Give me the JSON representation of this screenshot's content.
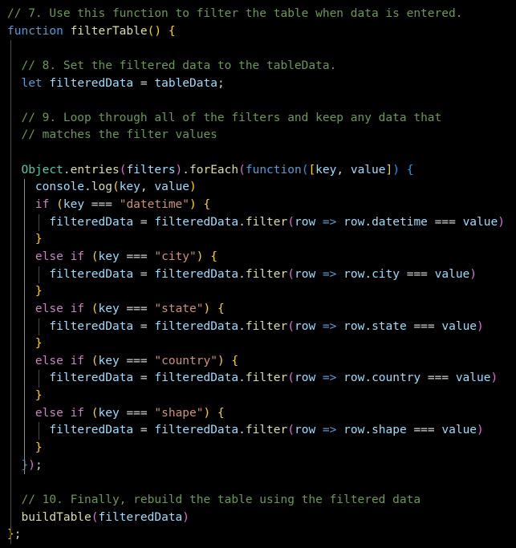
{
  "editor": {
    "language": "javascript",
    "theme": {
      "background": "#000000",
      "comment": "#6a9955",
      "keyword": "#569cd6",
      "control": "#c586c0",
      "function": "#dcdcaa",
      "variable": "#9cdcfe",
      "class": "#4ec9b0",
      "string": "#ce9178",
      "plain": "#d4d4d4",
      "bracket1": "#ffd700",
      "bracket2": "#da70d6",
      "bracket3": "#179fff"
    },
    "lines": [
      {
        "tokens": [
          [
            "tok-comment",
            "// 7. Use this function to filter the table when data is entered."
          ]
        ]
      },
      {
        "tokens": [
          [
            "tok-keyword",
            "function"
          ],
          [
            "tok-plain",
            " "
          ],
          [
            "tok-func",
            "filterTable"
          ],
          [
            "tok-b1",
            "()"
          ],
          [
            "tok-plain",
            " "
          ],
          [
            "tok-b1",
            "{"
          ]
        ]
      },
      {
        "tokens": []
      },
      {
        "tokens": [
          [
            "tok-plain",
            "  "
          ],
          [
            "tok-comment",
            "// 8. Set the filtered data to the tableData."
          ]
        ]
      },
      {
        "tokens": [
          [
            "tok-plain",
            "  "
          ],
          [
            "tok-keyword",
            "let"
          ],
          [
            "tok-plain",
            " "
          ],
          [
            "tok-var",
            "filteredData"
          ],
          [
            "tok-plain",
            " = "
          ],
          [
            "tok-var",
            "tableData"
          ],
          [
            "tok-plain",
            ";"
          ]
        ]
      },
      {
        "tokens": []
      },
      {
        "tokens": [
          [
            "tok-plain",
            "  "
          ],
          [
            "tok-comment",
            "// 9. Loop through all of the filters and keep any data that"
          ]
        ]
      },
      {
        "tokens": [
          [
            "tok-plain",
            "  "
          ],
          [
            "tok-comment",
            "// matches the filter values"
          ]
        ]
      },
      {
        "tokens": []
      },
      {
        "tokens": [
          [
            "tok-plain",
            "  "
          ],
          [
            "tok-class",
            "Object"
          ],
          [
            "tok-plain",
            "."
          ],
          [
            "tok-func",
            "entries"
          ],
          [
            "tok-b2",
            "("
          ],
          [
            "tok-var",
            "filters"
          ],
          [
            "tok-b2",
            ")"
          ],
          [
            "tok-plain",
            "."
          ],
          [
            "tok-func",
            "forEach"
          ],
          [
            "tok-b2",
            "("
          ],
          [
            "tok-keyword",
            "function"
          ],
          [
            "tok-b3",
            "("
          ],
          [
            "tok-b1",
            "["
          ],
          [
            "tok-var",
            "key"
          ],
          [
            "tok-plain",
            ", "
          ],
          [
            "tok-var",
            "value"
          ],
          [
            "tok-b1",
            "]"
          ],
          [
            "tok-b3",
            ")"
          ],
          [
            "tok-plain",
            " "
          ],
          [
            "tok-b3",
            "{"
          ]
        ]
      },
      {
        "tokens": [
          [
            "tok-plain",
            "    "
          ],
          [
            "tok-var",
            "console"
          ],
          [
            "tok-plain",
            "."
          ],
          [
            "tok-func",
            "log"
          ],
          [
            "tok-b1",
            "("
          ],
          [
            "tok-var",
            "key"
          ],
          [
            "tok-plain",
            ", "
          ],
          [
            "tok-var",
            "value"
          ],
          [
            "tok-b1",
            ")"
          ]
        ]
      },
      {
        "tokens": [
          [
            "tok-plain",
            "    "
          ],
          [
            "tok-ctrl",
            "if"
          ],
          [
            "tok-plain",
            " "
          ],
          [
            "tok-b1",
            "("
          ],
          [
            "tok-var",
            "key"
          ],
          [
            "tok-plain",
            " === "
          ],
          [
            "tok-string",
            "\"datetime\""
          ],
          [
            "tok-b1",
            ")"
          ],
          [
            "tok-plain",
            " "
          ],
          [
            "tok-b1",
            "{"
          ]
        ]
      },
      {
        "tokens": [
          [
            "tok-plain",
            "      "
          ],
          [
            "tok-var",
            "filteredData"
          ],
          [
            "tok-plain",
            " = "
          ],
          [
            "tok-var",
            "filteredData"
          ],
          [
            "tok-plain",
            "."
          ],
          [
            "tok-func",
            "filter"
          ],
          [
            "tok-b2",
            "("
          ],
          [
            "tok-var",
            "row"
          ],
          [
            "tok-plain",
            " "
          ],
          [
            "tok-keyword",
            "=>"
          ],
          [
            "tok-plain",
            " "
          ],
          [
            "tok-var",
            "row"
          ],
          [
            "tok-plain",
            "."
          ],
          [
            "tok-var",
            "datetime"
          ],
          [
            "tok-plain",
            " === "
          ],
          [
            "tok-var",
            "value"
          ],
          [
            "tok-b2",
            ")"
          ]
        ]
      },
      {
        "tokens": [
          [
            "tok-plain",
            "    "
          ],
          [
            "tok-b1",
            "}"
          ]
        ]
      },
      {
        "tokens": [
          [
            "tok-plain",
            "    "
          ],
          [
            "tok-ctrl",
            "else"
          ],
          [
            "tok-plain",
            " "
          ],
          [
            "tok-ctrl",
            "if"
          ],
          [
            "tok-plain",
            " "
          ],
          [
            "tok-b1",
            "("
          ],
          [
            "tok-var",
            "key"
          ],
          [
            "tok-plain",
            " === "
          ],
          [
            "tok-string",
            "\"city\""
          ],
          [
            "tok-b1",
            ")"
          ],
          [
            "tok-plain",
            " "
          ],
          [
            "tok-b1",
            "{"
          ]
        ]
      },
      {
        "tokens": [
          [
            "tok-plain",
            "      "
          ],
          [
            "tok-var",
            "filteredData"
          ],
          [
            "tok-plain",
            " = "
          ],
          [
            "tok-var",
            "filteredData"
          ],
          [
            "tok-plain",
            "."
          ],
          [
            "tok-func",
            "filter"
          ],
          [
            "tok-b2",
            "("
          ],
          [
            "tok-var",
            "row"
          ],
          [
            "tok-plain",
            " "
          ],
          [
            "tok-keyword",
            "=>"
          ],
          [
            "tok-plain",
            " "
          ],
          [
            "tok-var",
            "row"
          ],
          [
            "tok-plain",
            "."
          ],
          [
            "tok-var",
            "city"
          ],
          [
            "tok-plain",
            " === "
          ],
          [
            "tok-var",
            "value"
          ],
          [
            "tok-b2",
            ")"
          ]
        ]
      },
      {
        "tokens": [
          [
            "tok-plain",
            "    "
          ],
          [
            "tok-b1",
            "}"
          ]
        ]
      },
      {
        "tokens": [
          [
            "tok-plain",
            "    "
          ],
          [
            "tok-ctrl",
            "else"
          ],
          [
            "tok-plain",
            " "
          ],
          [
            "tok-ctrl",
            "if"
          ],
          [
            "tok-plain",
            " "
          ],
          [
            "tok-b1",
            "("
          ],
          [
            "tok-var",
            "key"
          ],
          [
            "tok-plain",
            " === "
          ],
          [
            "tok-string",
            "\"state\""
          ],
          [
            "tok-b1",
            ")"
          ],
          [
            "tok-plain",
            " "
          ],
          [
            "tok-b1",
            "{"
          ]
        ]
      },
      {
        "tokens": [
          [
            "tok-plain",
            "      "
          ],
          [
            "tok-var",
            "filteredData"
          ],
          [
            "tok-plain",
            " = "
          ],
          [
            "tok-var",
            "filteredData"
          ],
          [
            "tok-plain",
            "."
          ],
          [
            "tok-func",
            "filter"
          ],
          [
            "tok-b2",
            "("
          ],
          [
            "tok-var",
            "row"
          ],
          [
            "tok-plain",
            " "
          ],
          [
            "tok-keyword",
            "=>"
          ],
          [
            "tok-plain",
            " "
          ],
          [
            "tok-var",
            "row"
          ],
          [
            "tok-plain",
            "."
          ],
          [
            "tok-var",
            "state"
          ],
          [
            "tok-plain",
            " === "
          ],
          [
            "tok-var",
            "value"
          ],
          [
            "tok-b2",
            ")"
          ]
        ]
      },
      {
        "tokens": [
          [
            "tok-plain",
            "    "
          ],
          [
            "tok-b1",
            "}"
          ]
        ]
      },
      {
        "tokens": [
          [
            "tok-plain",
            "    "
          ],
          [
            "tok-ctrl",
            "else"
          ],
          [
            "tok-plain",
            " "
          ],
          [
            "tok-ctrl",
            "if"
          ],
          [
            "tok-plain",
            " "
          ],
          [
            "tok-b1",
            "("
          ],
          [
            "tok-var",
            "key"
          ],
          [
            "tok-plain",
            " === "
          ],
          [
            "tok-string",
            "\"country\""
          ],
          [
            "tok-b1",
            ")"
          ],
          [
            "tok-plain",
            " "
          ],
          [
            "tok-b1",
            "{"
          ]
        ]
      },
      {
        "tokens": [
          [
            "tok-plain",
            "      "
          ],
          [
            "tok-var",
            "filteredData"
          ],
          [
            "tok-plain",
            " = "
          ],
          [
            "tok-var",
            "filteredData"
          ],
          [
            "tok-plain",
            "."
          ],
          [
            "tok-func",
            "filter"
          ],
          [
            "tok-b2",
            "("
          ],
          [
            "tok-var",
            "row"
          ],
          [
            "tok-plain",
            " "
          ],
          [
            "tok-keyword",
            "=>"
          ],
          [
            "tok-plain",
            " "
          ],
          [
            "tok-var",
            "row"
          ],
          [
            "tok-plain",
            "."
          ],
          [
            "tok-var",
            "country"
          ],
          [
            "tok-plain",
            " === "
          ],
          [
            "tok-var",
            "value"
          ],
          [
            "tok-b2",
            ")"
          ]
        ]
      },
      {
        "tokens": [
          [
            "tok-plain",
            "    "
          ],
          [
            "tok-b1",
            "}"
          ]
        ]
      },
      {
        "tokens": [
          [
            "tok-plain",
            "    "
          ],
          [
            "tok-ctrl",
            "else"
          ],
          [
            "tok-plain",
            " "
          ],
          [
            "tok-ctrl",
            "if"
          ],
          [
            "tok-plain",
            " "
          ],
          [
            "tok-b1",
            "("
          ],
          [
            "tok-var",
            "key"
          ],
          [
            "tok-plain",
            " === "
          ],
          [
            "tok-string",
            "\"shape\""
          ],
          [
            "tok-b1",
            ")"
          ],
          [
            "tok-plain",
            " "
          ],
          [
            "tok-b1",
            "{"
          ]
        ]
      },
      {
        "tokens": [
          [
            "tok-plain",
            "      "
          ],
          [
            "tok-var",
            "filteredData"
          ],
          [
            "tok-plain",
            " = "
          ],
          [
            "tok-var",
            "filteredData"
          ],
          [
            "tok-plain",
            "."
          ],
          [
            "tok-func",
            "filter"
          ],
          [
            "tok-b2",
            "("
          ],
          [
            "tok-var",
            "row"
          ],
          [
            "tok-plain",
            " "
          ],
          [
            "tok-keyword",
            "=>"
          ],
          [
            "tok-plain",
            " "
          ],
          [
            "tok-var",
            "row"
          ],
          [
            "tok-plain",
            "."
          ],
          [
            "tok-var",
            "shape"
          ],
          [
            "tok-plain",
            " === "
          ],
          [
            "tok-var",
            "value"
          ],
          [
            "tok-b2",
            ")"
          ]
        ]
      },
      {
        "tokens": [
          [
            "tok-plain",
            "    "
          ],
          [
            "tok-b1",
            "}"
          ]
        ]
      },
      {
        "tokens": [
          [
            "tok-plain",
            "  "
          ],
          [
            "tok-b3",
            "}"
          ],
          [
            "tok-b2",
            ")"
          ],
          [
            "tok-plain",
            ";"
          ]
        ]
      },
      {
        "tokens": []
      },
      {
        "tokens": [
          [
            "tok-plain",
            "  "
          ],
          [
            "tok-comment",
            "// 10. Finally, rebuild the table using the filtered data"
          ]
        ]
      },
      {
        "tokens": [
          [
            "tok-plain",
            "  "
          ],
          [
            "tok-func",
            "buildTable"
          ],
          [
            "tok-b2",
            "("
          ],
          [
            "tok-var",
            "filteredData"
          ],
          [
            "tok-b2",
            ")"
          ]
        ]
      },
      {
        "tokens": [
          [
            "tok-b1",
            "}"
          ],
          [
            "tok-plain",
            ";"
          ]
        ]
      }
    ]
  }
}
